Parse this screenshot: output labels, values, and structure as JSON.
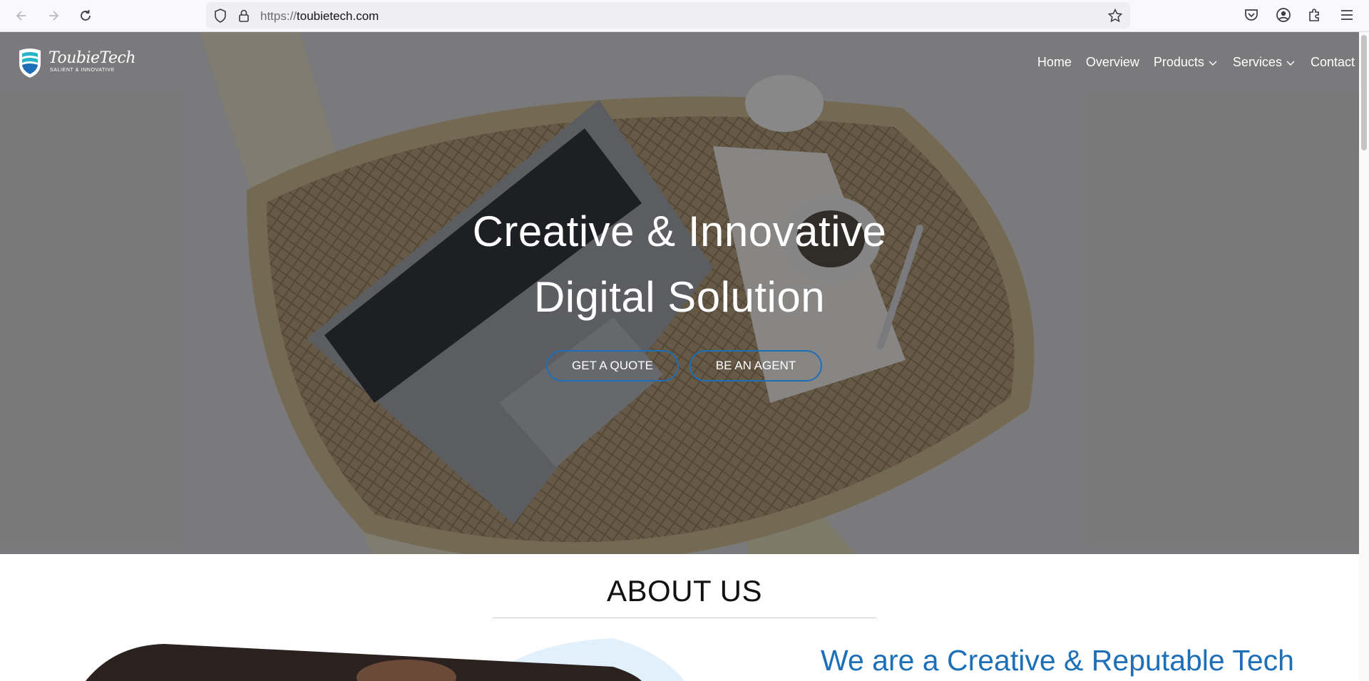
{
  "browser": {
    "url_protocol": "https://",
    "url_host": "toubietech.com",
    "icons": [
      "back-icon",
      "forward-icon",
      "reload-icon",
      "shield-icon",
      "lock-icon",
      "bookmark-star-icon",
      "pocket-icon",
      "account-icon",
      "extensions-icon",
      "menu-icon"
    ]
  },
  "site": {
    "logo_name": "ToubieTech",
    "logo_tagline": "SALIENT & INNOVATIVE",
    "nav": {
      "home": "Home",
      "overview": "Overview",
      "products": "Products",
      "services": "Services",
      "contact": "Contact"
    },
    "hero": {
      "line1": "Creative & Innovative",
      "line2": "Digital Solution",
      "quote_btn": "GET A QUOTE",
      "agent_btn": "BE AN AGENT"
    },
    "about": {
      "title": "ABOUT US",
      "heading": "We are a Creative & Reputable Tech"
    },
    "colors": {
      "accent": "#1d6fb8",
      "logo_teal": "#2bb3c9"
    }
  }
}
